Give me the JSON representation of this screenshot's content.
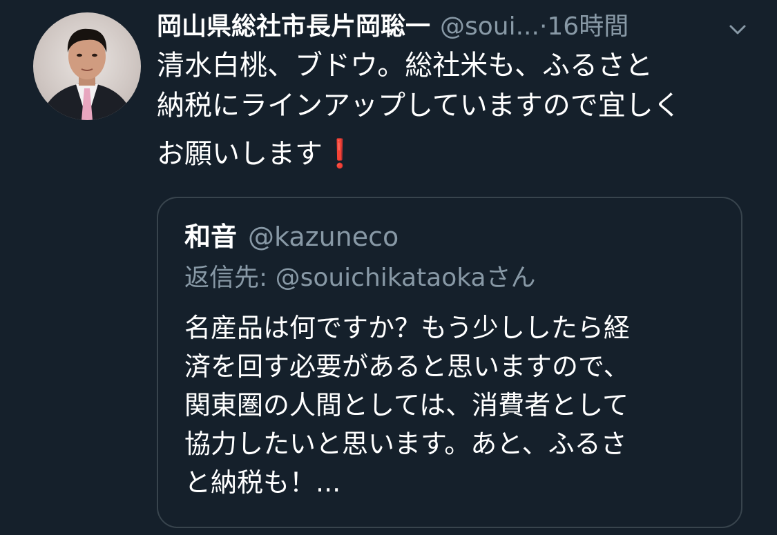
{
  "tweet": {
    "author": {
      "display_name": "岡山県総社市長片岡聡一",
      "handle": "@soui...",
      "separator": "·",
      "time": "16時間"
    },
    "body_lines": [
      "清水白桃、ブドウ。総社米も、ふるさと",
      "納税にラインアップしていますので宜しく",
      "お願いします"
    ],
    "emoji": "❗",
    "menu_icon": "chevron-down-icon",
    "quoted": {
      "display_name": "和音",
      "handle": "@kazuneco",
      "reply_label": "返信先: ",
      "reply_user": "@souichikataokaさん",
      "text_lines": [
        "名産品は何ですか？もう少ししたら経",
        "済を回す必要があると思いますので、",
        "関東圏の人間としては、消費者として",
        "協力したいと思います。あと、ふるさ",
        "と納税も！..."
      ]
    }
  },
  "colors": {
    "background": "#15202b",
    "primary_text": "#ffffff",
    "secondary_text": "#8899a6",
    "border": "#38444d",
    "emoji_red": "#e0212f"
  }
}
